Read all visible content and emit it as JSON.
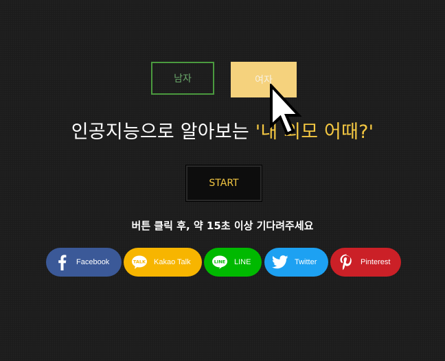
{
  "gender": {
    "male_label": "남자",
    "female_label": "여자"
  },
  "headline": {
    "prefix": "인공지능으로 알아보는 ",
    "accent": "'내 외모 어때?'"
  },
  "start_label": "START",
  "notice": "버튼 클릭 후, 약 15초 이상 기다려주세요",
  "share": [
    {
      "label": "Facebook",
      "icon": "facebook-icon",
      "color": "#3b5998"
    },
    {
      "label": "Kakao Talk",
      "icon": "kakaotalk-icon",
      "color": "#f7b500"
    },
    {
      "label": "LINE",
      "icon": "line-icon",
      "color": "#00b900"
    },
    {
      "label": "Twitter",
      "icon": "twitter-icon",
      "color": "#1da1f2"
    },
    {
      "label": "Pinterest",
      "icon": "pinterest-icon",
      "color": "#cb2027"
    }
  ],
  "colors": {
    "accent": "#f5c842",
    "male_border": "#4b9b3f",
    "female_fill": "#f5d27d",
    "background": "#1c1c1c"
  }
}
